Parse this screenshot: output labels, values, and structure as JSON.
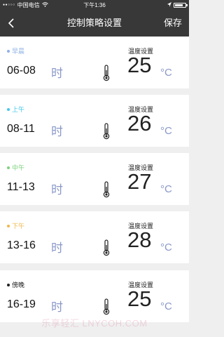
{
  "status_bar": {
    "carrier": "中国电信",
    "time": "下午1:36"
  },
  "nav": {
    "title": "控制策略设置",
    "save_label": "保存"
  },
  "temp_label": "温度设置",
  "hour_unit": "时",
  "temp_unit": "°C",
  "schedules": [
    {
      "period": "早晨",
      "range": "06-08",
      "temperature": "25",
      "dot_color": "#8fb1e6"
    },
    {
      "period": "上午",
      "range": "08-11",
      "temperature": "26",
      "dot_color": "#45c8e8"
    },
    {
      "period": "中午",
      "range": "11-13",
      "temperature": "27",
      "dot_color": "#7fd27f"
    },
    {
      "period": "下午",
      "range": "13-16",
      "temperature": "28",
      "dot_color": "#f0b84a"
    },
    {
      "period": "傍晚",
      "range": "16-19",
      "temperature": "25",
      "dot_color": "#222222"
    }
  ],
  "colors": {
    "nav_bg": "#383838",
    "accent_unit": "#8a98c8",
    "page_bg": "#efefef"
  },
  "watermark": "乐享轻汇 LNYCOH.COM"
}
